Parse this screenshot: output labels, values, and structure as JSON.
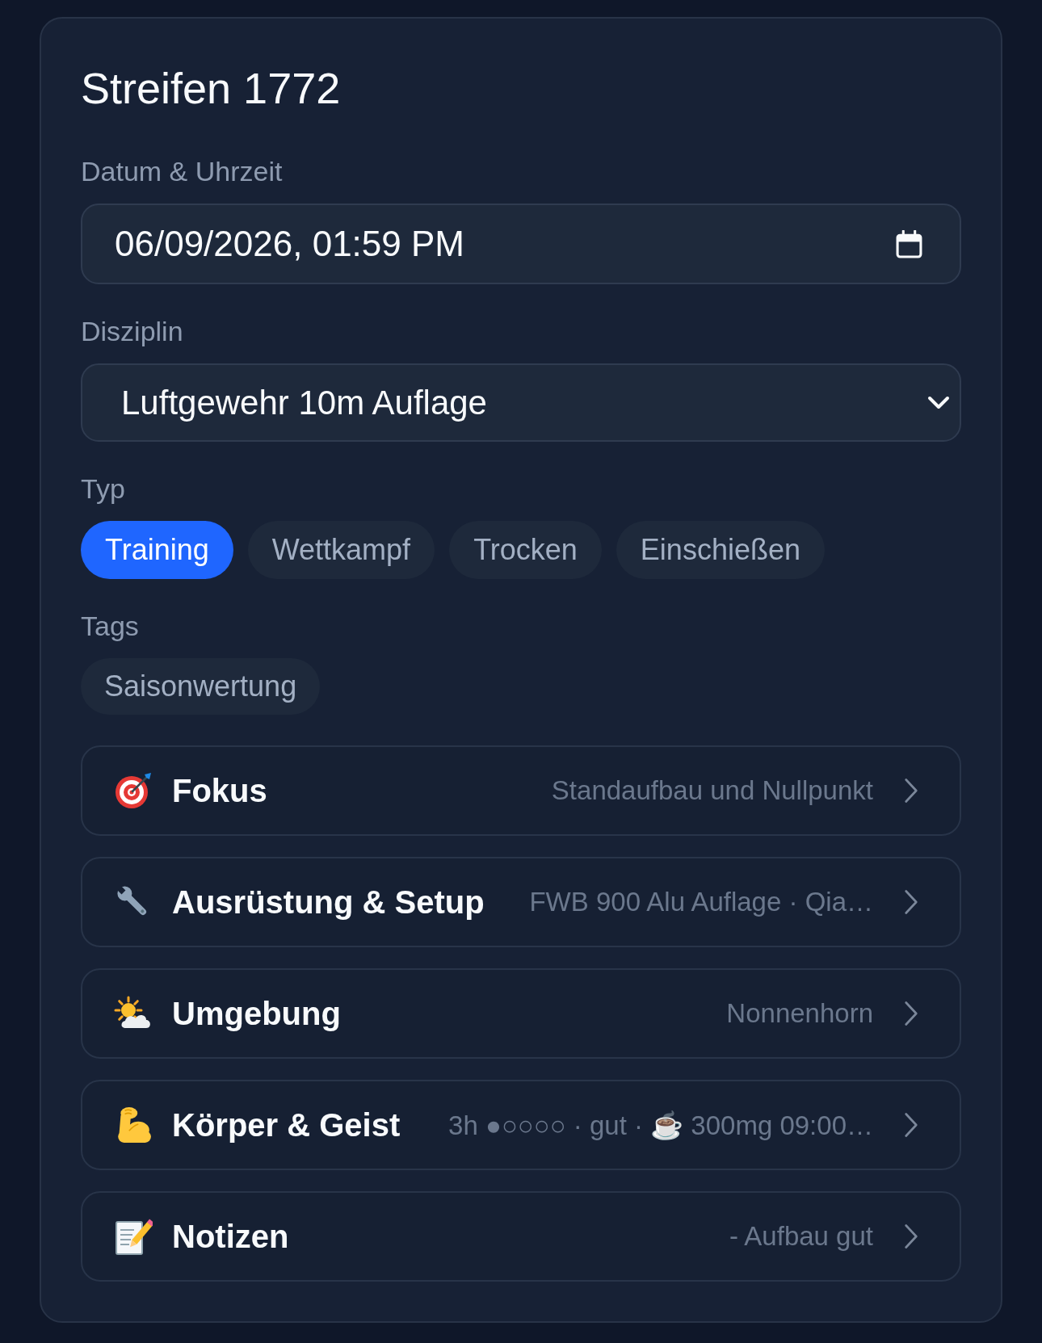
{
  "card": {
    "title": "Streifen 1772"
  },
  "datetime": {
    "label": "Datum & Uhrzeit",
    "value": "06/09/2026, 01:59 PM"
  },
  "discipline": {
    "label": "Disziplin",
    "value": "Luftgewehr 10m Auflage"
  },
  "type": {
    "label": "Typ",
    "options": [
      {
        "label": "Training",
        "selected": true
      },
      {
        "label": "Wettkampf",
        "selected": false
      },
      {
        "label": "Trocken",
        "selected": false
      },
      {
        "label": "Einschießen",
        "selected": false
      }
    ]
  },
  "tags": {
    "label": "Tags",
    "items": [
      {
        "label": "Saisonwertung",
        "selected": false
      }
    ]
  },
  "sections": [
    {
      "title": "Fokus",
      "summary": "Standaufbau und Nullpunkt"
    },
    {
      "title": "Ausrüstung & Setup",
      "summary": "FWB 900 Alu Auflage · Qia…"
    },
    {
      "title": "Umgebung",
      "summary": "Nonnenhorn"
    },
    {
      "title": "Körper & Geist",
      "summary": "3h ●○○○○ · gut · ☕ 300mg 09:00…"
    },
    {
      "title": "Notizen",
      "summary": "- Aufbau gut"
    }
  ]
}
